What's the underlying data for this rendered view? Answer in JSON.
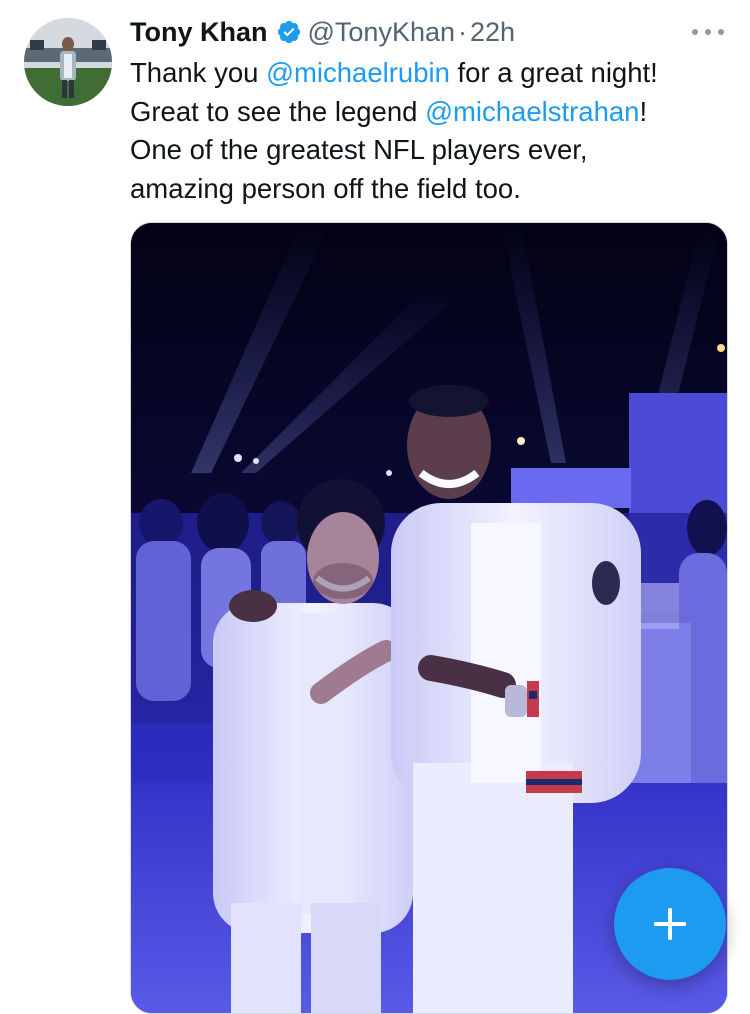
{
  "tweet": {
    "author_name": "Tony Khan",
    "handle": "@TonyKhan",
    "separator": "·",
    "timestamp": "22h",
    "lines": [
      {
        "before": "Thank you ",
        "mention": "@michaelrubin",
        "after": " for a great night!"
      },
      {
        "before": "Great to see the legend ",
        "mention": "@michaelstrahan",
        "after": "!"
      },
      {
        "before": "One of the greatest NFL players ever,",
        "mention": "",
        "after": ""
      },
      {
        "before": "amazing person off the field too.",
        "mention": "",
        "after": ""
      }
    ]
  },
  "icons": {
    "verified": "verified-badge-icon",
    "more": "more-dots-icon",
    "compose": "plus-icon"
  },
  "colors": {
    "accent": "#1d9bf0",
    "text": "#0f1419",
    "secondary": "#536471"
  }
}
